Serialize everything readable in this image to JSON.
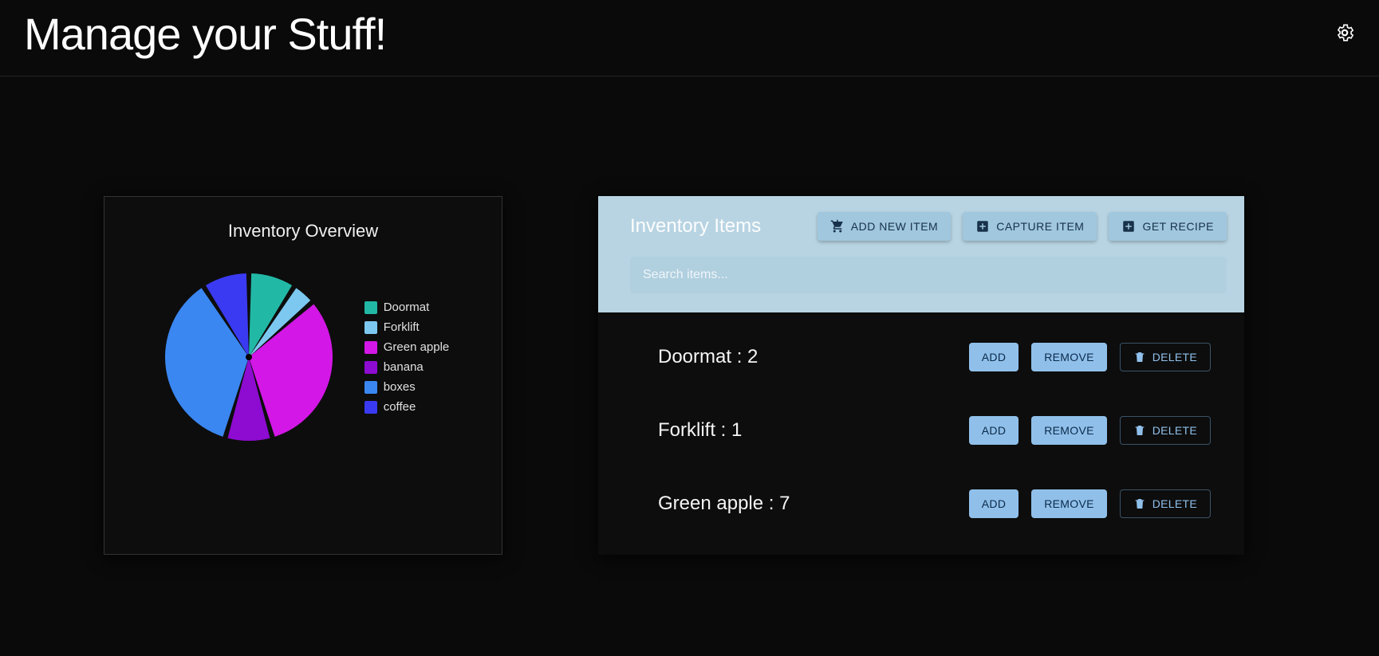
{
  "header": {
    "title": "Manage your Stuff!"
  },
  "chart": {
    "title": "Inventory Overview"
  },
  "chart_data": {
    "type": "pie",
    "title": "Inventory Overview",
    "series": [
      {
        "name": "Doormat",
        "value": 2,
        "color": "#22b8a6"
      },
      {
        "name": "Forklift",
        "value": 1,
        "color": "#7dc8f0"
      },
      {
        "name": "Green apple",
        "value": 7,
        "color": "#d317e6"
      },
      {
        "name": "banana",
        "value": 2,
        "color": "#8e0bd1"
      },
      {
        "name": "boxes",
        "value": 8,
        "color": "#3a87f2"
      },
      {
        "name": "coffee",
        "value": 2,
        "color": "#3a3af2"
      }
    ]
  },
  "inventory": {
    "title": "Inventory Items",
    "search_placeholder": "Search items...",
    "toolbar": {
      "add_new": "ADD NEW ITEM",
      "capture": "CAPTURE ITEM",
      "recipe": "GET RECIPE"
    },
    "row_buttons": {
      "add": "ADD",
      "remove": "REMOVE",
      "delete": "DELETE"
    },
    "items": [
      {
        "name": "Doormat",
        "count": 2
      },
      {
        "name": "Forklift",
        "count": 1
      },
      {
        "name": "Green apple",
        "count": 7
      }
    ]
  }
}
